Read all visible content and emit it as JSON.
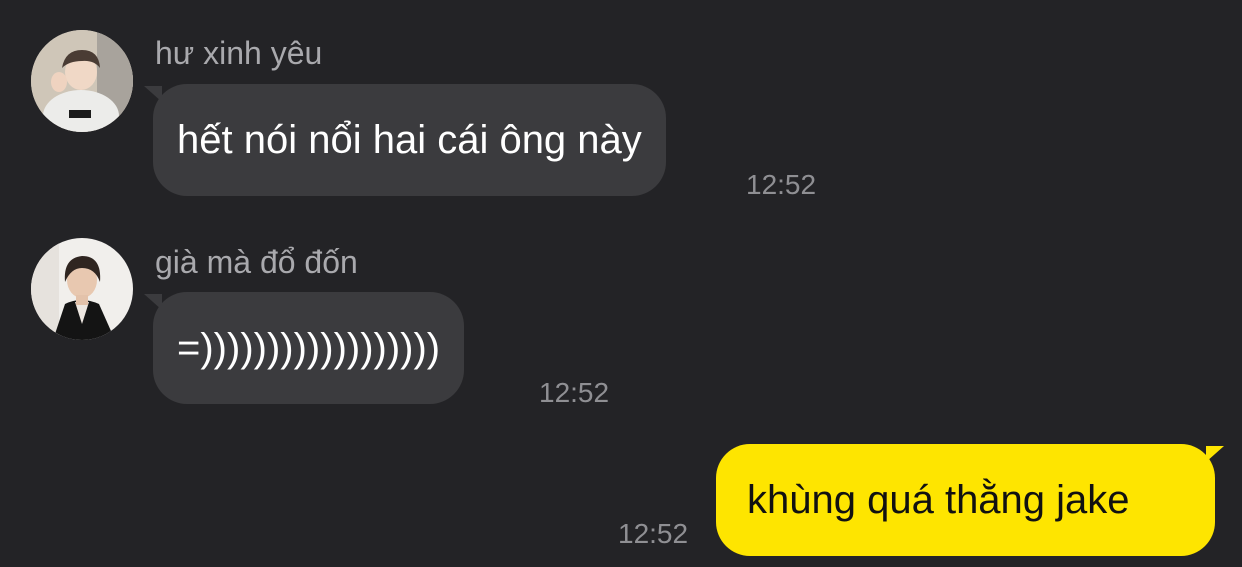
{
  "messages": [
    {
      "sender": "hư xinh yêu",
      "text": "hết nói nổi hai cái ông này",
      "time": "12:52",
      "avatar": "profile-photo"
    },
    {
      "sender": "già mà đổ đốn",
      "text": "=))))))))))))))))))",
      "time": "12:52",
      "avatar": "profile-photo"
    },
    {
      "text": "khùng quá thằng jake",
      "time": "12:52"
    }
  ],
  "colors": {
    "background": "#232326",
    "incoming_bubble": "#3b3b3e",
    "outgoing_bubble": "#fee500",
    "sender_name": "#a9a9ad",
    "timestamp": "#8f8f93"
  }
}
